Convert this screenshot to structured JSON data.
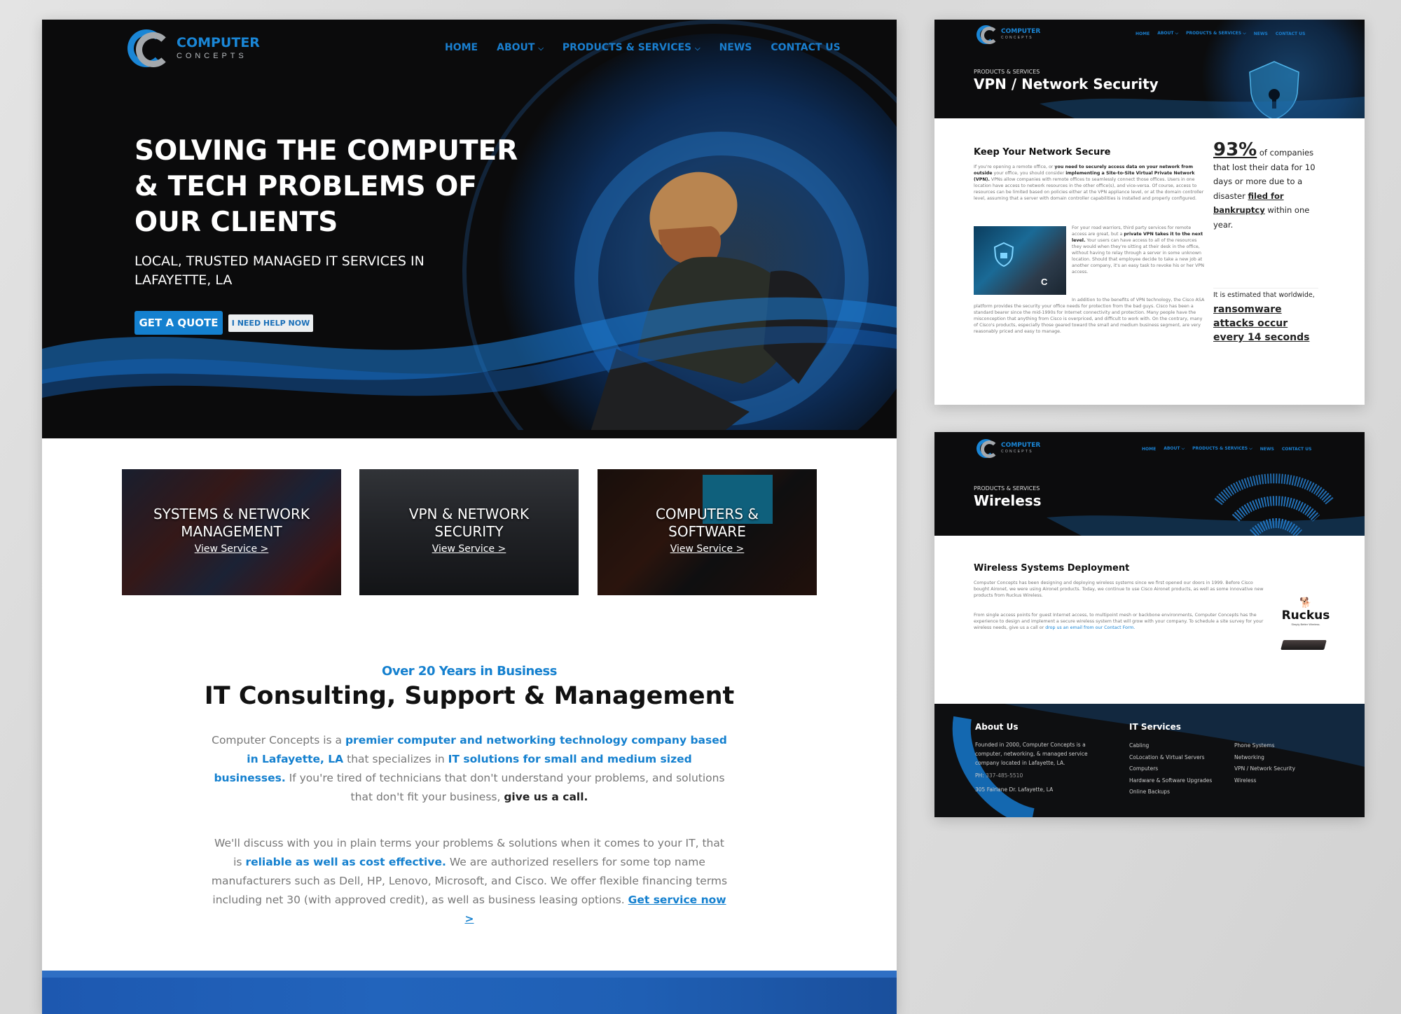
{
  "brand": {
    "line1": "COMPUTER",
    "line2": "CONCEPTS",
    "accent": "#1480cf",
    "grey": "#a5a9ad"
  },
  "nav": {
    "items": [
      {
        "label": "HOME",
        "dropdown": false
      },
      {
        "label": "ABOUT",
        "dropdown": true
      },
      {
        "label": "PRODUCTS & SERVICES",
        "dropdown": true
      },
      {
        "label": "NEWS",
        "dropdown": false
      },
      {
        "label": "CONTACT US",
        "dropdown": false
      }
    ],
    "chevron": "⌄"
  },
  "home": {
    "hero": {
      "title": "SOLVING THE COMPUTER & TECH PROBLEMS OF OUR CLIENTS",
      "subtitle": "LOCAL, TRUSTED MANAGED IT SERVICES IN LAFAYETTE, LA",
      "primary_button": "GET A QUOTE",
      "secondary_button": "I NEED HELP NOW"
    },
    "services": [
      {
        "title_1": "SYSTEMS & NETWORK",
        "title_2": "MANAGEMENT",
        "link": "View Service >"
      },
      {
        "title_1": "VPN & NETWORK",
        "title_2": "SECURITY",
        "link": "View Service >"
      },
      {
        "title_1": "COMPUTERS &",
        "title_2": "SOFTWARE",
        "link": "View Service >"
      }
    ],
    "about": {
      "kicker": "Over 20 Years in Business",
      "heading": "IT Consulting, Support & Management",
      "p1": {
        "t1": "Computer Concepts is a ",
        "b1": "premier computer and networking technology company based in Lafayette, LA",
        "t2": " that specializes in ",
        "b2": "IT solutions for small and medium sized businesses.",
        "t3": " If you're tired of technicians that don't understand your problems, and solutions that don't fit your business, ",
        "k1": "give us a call."
      },
      "p2": {
        "t1": "We'll discuss with you in plain terms your problems & solutions when it comes to your IT, that is ",
        "b1": "reliable as well as cost effective.",
        "t2": " We are authorized resellers for some top name manufacturers such as Dell, HP, Lenovo, Microsoft, and Cisco. We offer flexible financing terms including net 30 (with approved credit), as well as business leasing options. ",
        "link": "Get service now >"
      }
    }
  },
  "vpn_page": {
    "kicker": "PRODUCTS & SERVICES",
    "title": "VPN / Network Security",
    "heading": "Keep Your Network Secure",
    "p1": {
      "t1": "If you're opening a remote office, or ",
      "b1": "you need to securely access data on your network from outside",
      "t2": " your office, you should consider ",
      "b2": "implementing a Site-to-Site Virtual Private Network (VPN).",
      "t3": " VPNs allow companies with remote offices to seamlessly connect those offices. Users in one location have access to network resources in the other office(s), and vice-versa. Of course, access to resources can be limited based on policies either at the VPN appliance level, or at the domain controller level, assuming that a server with domain controller capabilities is installed and properly configured."
    },
    "p2": {
      "t1": "For your road warriors, third party services for remote access are great, but a ",
      "b1": "private VPN takes it to the next level.",
      "t2": " Your users can have access to all of the resources they would when they're sitting at their desk in the office, without having to relay through a server in some unknown location. Should that employee decide to take a new job at another company, it's an easy task to revoke his or her VPN access."
    },
    "p3": "In addition to the benefits of VPN technology, the Cisco ASA platform provides the security your office needs for protection from the bad guys. Cisco has been a standard bearer since the mid-1990s for Internet connectivity and protection. Many people have the misconception that anything from Cisco is overpriced, and difficult to work with. On the contrary, many of Cisco's products, especially those geared toward the small and medium business segment, are very reasonably priced and easy to manage.",
    "stat1": {
      "number": "93%",
      "t1": " of companies that lost their data for 10 days or more due to a disaster ",
      "b1": "filed for bankruptcy",
      "t2": " within one year."
    },
    "stat2": {
      "t1": "It is estimated that worldwide,",
      "b1": "ransomware attacks occur every 14 seconds"
    }
  },
  "wireless_page": {
    "kicker": "PRODUCTS & SERVICES",
    "title": "Wireless",
    "heading": "Wireless Systems Deployment",
    "p1": "Computer Concepts has been designing and deploying wireless systems since we first opened our doors in 1999. Before Cisco bought Aironet, we were using Aironet products.  Today, we continue to use Cisco Aironet products, as well as some innovative new products from Ruckus Wireless.",
    "p2": {
      "t1": "From single access points for guest Internet access, to multipoint mesh or backbone environments, Computer Concepts has the experience to design and implement a secure wireless system that will grow with your company.  To schedule a site survey for your wireless needs, give us a call or ",
      "link": "drop us an email from our Contact Form."
    },
    "partner": {
      "name": "Ruckus",
      "tagline": "Simply Better Wireless."
    }
  },
  "footer": {
    "about_heading": "About Us",
    "about_text": "Founded in 2000, Computer Concepts is a computer, networking, & managed service company located in Lafayette, LA.",
    "phone_label": "PH:",
    "phone": "337-485-5510",
    "address": "305 Fairlane Dr. Lafayette, LA",
    "services_heading": "IT Services",
    "services_col1": [
      "Cabling",
      "CoLocation & Virtual Servers",
      "Computers",
      "Hardware & Software Upgrades",
      "Online Backups"
    ],
    "services_col2": [
      "Phone Systems",
      "Networking",
      "VPN / Network Security",
      "Wireless"
    ]
  }
}
